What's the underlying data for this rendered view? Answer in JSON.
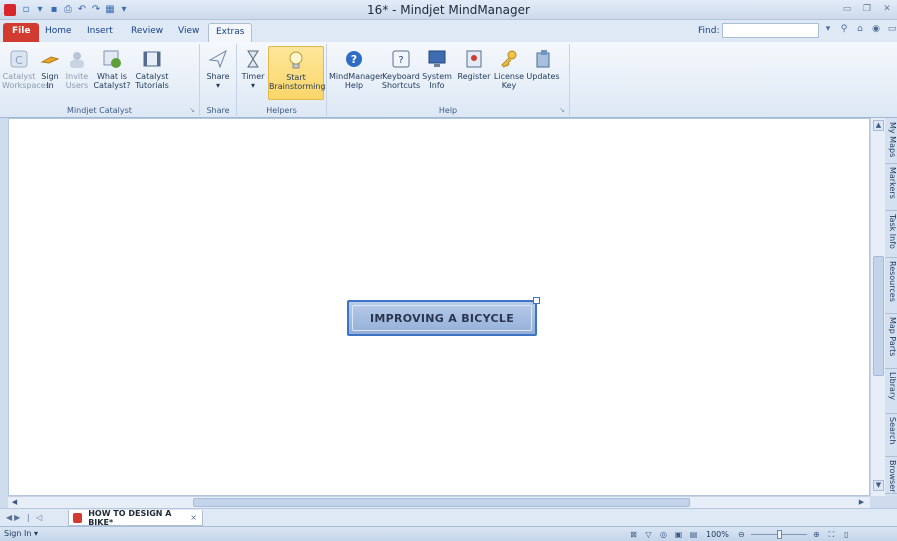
{
  "window": {
    "title": "16* - Mindjet MindManager",
    "qat_icons": [
      "new-icon",
      "open-icon",
      "save-icon",
      "print-icon",
      "undo-icon",
      "redo-icon",
      "layout-icon",
      "customize-icon"
    ]
  },
  "tabs": [
    {
      "label": "File",
      "type": "file"
    },
    {
      "label": "Home"
    },
    {
      "label": "Insert"
    },
    {
      "label": "Review"
    },
    {
      "label": "View"
    },
    {
      "label": "Extras",
      "active": true
    }
  ],
  "find": {
    "label": "Find:",
    "value": ""
  },
  "ribbon": {
    "groups": [
      {
        "label": "Mindjet Catalyst",
        "buttons": [
          {
            "label": "Catalyst\nWorkspaces",
            "icon": "catalyst-icon",
            "disabled": true
          },
          {
            "label": "Sign\nIn",
            "icon": "sign-in-icon"
          },
          {
            "label": "Invite\nUsers",
            "icon": "invite-users-icon",
            "disabled": true
          },
          {
            "label": "What is\nCatalyst?",
            "icon": "what-is-catalyst-icon"
          },
          {
            "label": "Catalyst\nTutorials",
            "icon": "tutorials-icon"
          }
        ]
      },
      {
        "label": "Share",
        "buttons": [
          {
            "label": "Share\n▾",
            "icon": "share-icon"
          }
        ]
      },
      {
        "label": "Helpers",
        "buttons": [
          {
            "label": "Timer\n▾",
            "icon": "timer-icon"
          },
          {
            "label": "Start\nBrainstorming",
            "icon": "lightbulb-icon",
            "highlight": true
          }
        ]
      },
      {
        "label": "Help",
        "buttons": [
          {
            "label": "MindManager\nHelp",
            "icon": "help-icon"
          },
          {
            "label": "Keyboard\nShortcuts",
            "icon": "keyboard-icon"
          },
          {
            "label": "System\nInfo",
            "icon": "system-info-icon"
          },
          {
            "label": "Register",
            "icon": "register-icon"
          },
          {
            "label": "License\nKey",
            "icon": "key-icon"
          },
          {
            "label": "Updates",
            "icon": "updates-icon"
          }
        ]
      }
    ]
  },
  "canvas": {
    "central_topic": "IMPROVING A BICYCLE"
  },
  "side_panel": {
    "tabs": [
      "My Maps",
      "Markers",
      "Task Info",
      "Resources",
      "Map Parts",
      "Library",
      "Search",
      "Browser"
    ]
  },
  "document_tabs": [
    {
      "label": "HOW TO DESIGN A BIKE*",
      "close": "×"
    }
  ],
  "statusbar": {
    "sign_in": "Sign In ▾",
    "zoom": "100%"
  },
  "colors": {
    "file_tab": "#d23b2f",
    "topic_fill": "#a7bfe2",
    "topic_border": "#3d74c5",
    "brainstorm_highlight": "#fbd66a"
  }
}
